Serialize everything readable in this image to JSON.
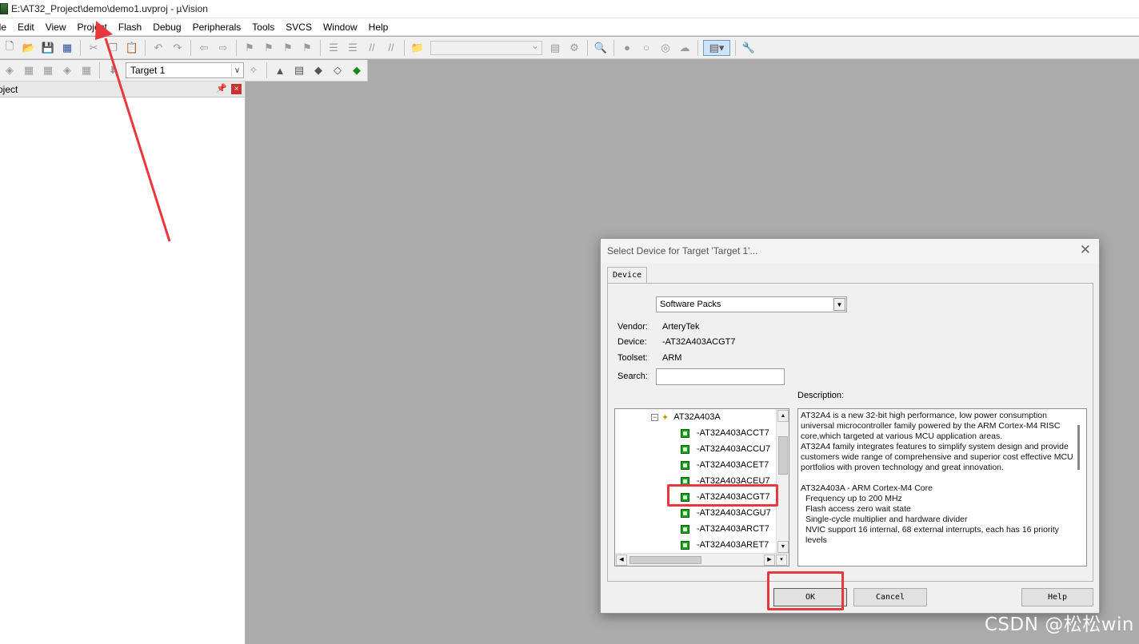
{
  "window": {
    "title": "E:\\AT32_Project\\demo\\demo1.uvproj - µVision"
  },
  "menu": {
    "items": [
      "ile",
      "Edit",
      "View",
      "Project",
      "Flash",
      "Debug",
      "Peripherals",
      "Tools",
      "SVCS",
      "Window",
      "Help"
    ]
  },
  "toolbar": {
    "target": "Target 1"
  },
  "project_pane": {
    "title": "oject",
    "pin": "📌",
    "close": "×"
  },
  "dialog": {
    "title": "Select Device for Target 'Target 1'...",
    "close": "✕",
    "tab": "Device",
    "pack_select": "Software Packs",
    "labels": {
      "vendor": "Vendor:",
      "device": "Device:",
      "toolset": "Toolset:",
      "search": "Search:"
    },
    "values": {
      "vendor": "ArteryTek",
      "device": "-AT32A403ACGT7",
      "toolset": "ARM"
    },
    "search_value": "",
    "description_label": "Description:",
    "tree": {
      "family": "AT32A403A",
      "items": [
        "-AT32A403ACCT7",
        "-AT32A403ACCU7",
        "-AT32A403ACET7",
        "-AT32A403ACEU7",
        "-AT32A403ACGT7",
        "-AT32A403ACGU7",
        "-AT32A403ARCT7",
        "-AT32A403ARET7"
      ]
    },
    "description": {
      "para1": "AT32A4 is a new 32-bit high performance, low power consumption universal microcontroller family powered by the ARM Cortex-M4 RISC core,which targeted at various MCU application areas.",
      "para2": "AT32A4 family integrates features to simplify system design and provide customers wide range of comprehensive and superior cost effective MCU portfolios with proven technology and great innovation.",
      "core_title": "AT32A403A - ARM Cortex-M4 Core",
      "features": [
        "Frequency up to 200 MHz",
        "Flash access zero wait state",
        "Single-cycle multiplier and hardware divider",
        "NVIC support 16 internal, 68 external interrupts, each has 16 priority levels"
      ]
    },
    "buttons": {
      "ok": "OK",
      "cancel": "Cancel",
      "help": "Help"
    }
  },
  "watermark": "CSDN @松松win",
  "colors": {
    "annotation": "#e8383d",
    "workspace": "#ababab",
    "chip": "#18a418"
  }
}
